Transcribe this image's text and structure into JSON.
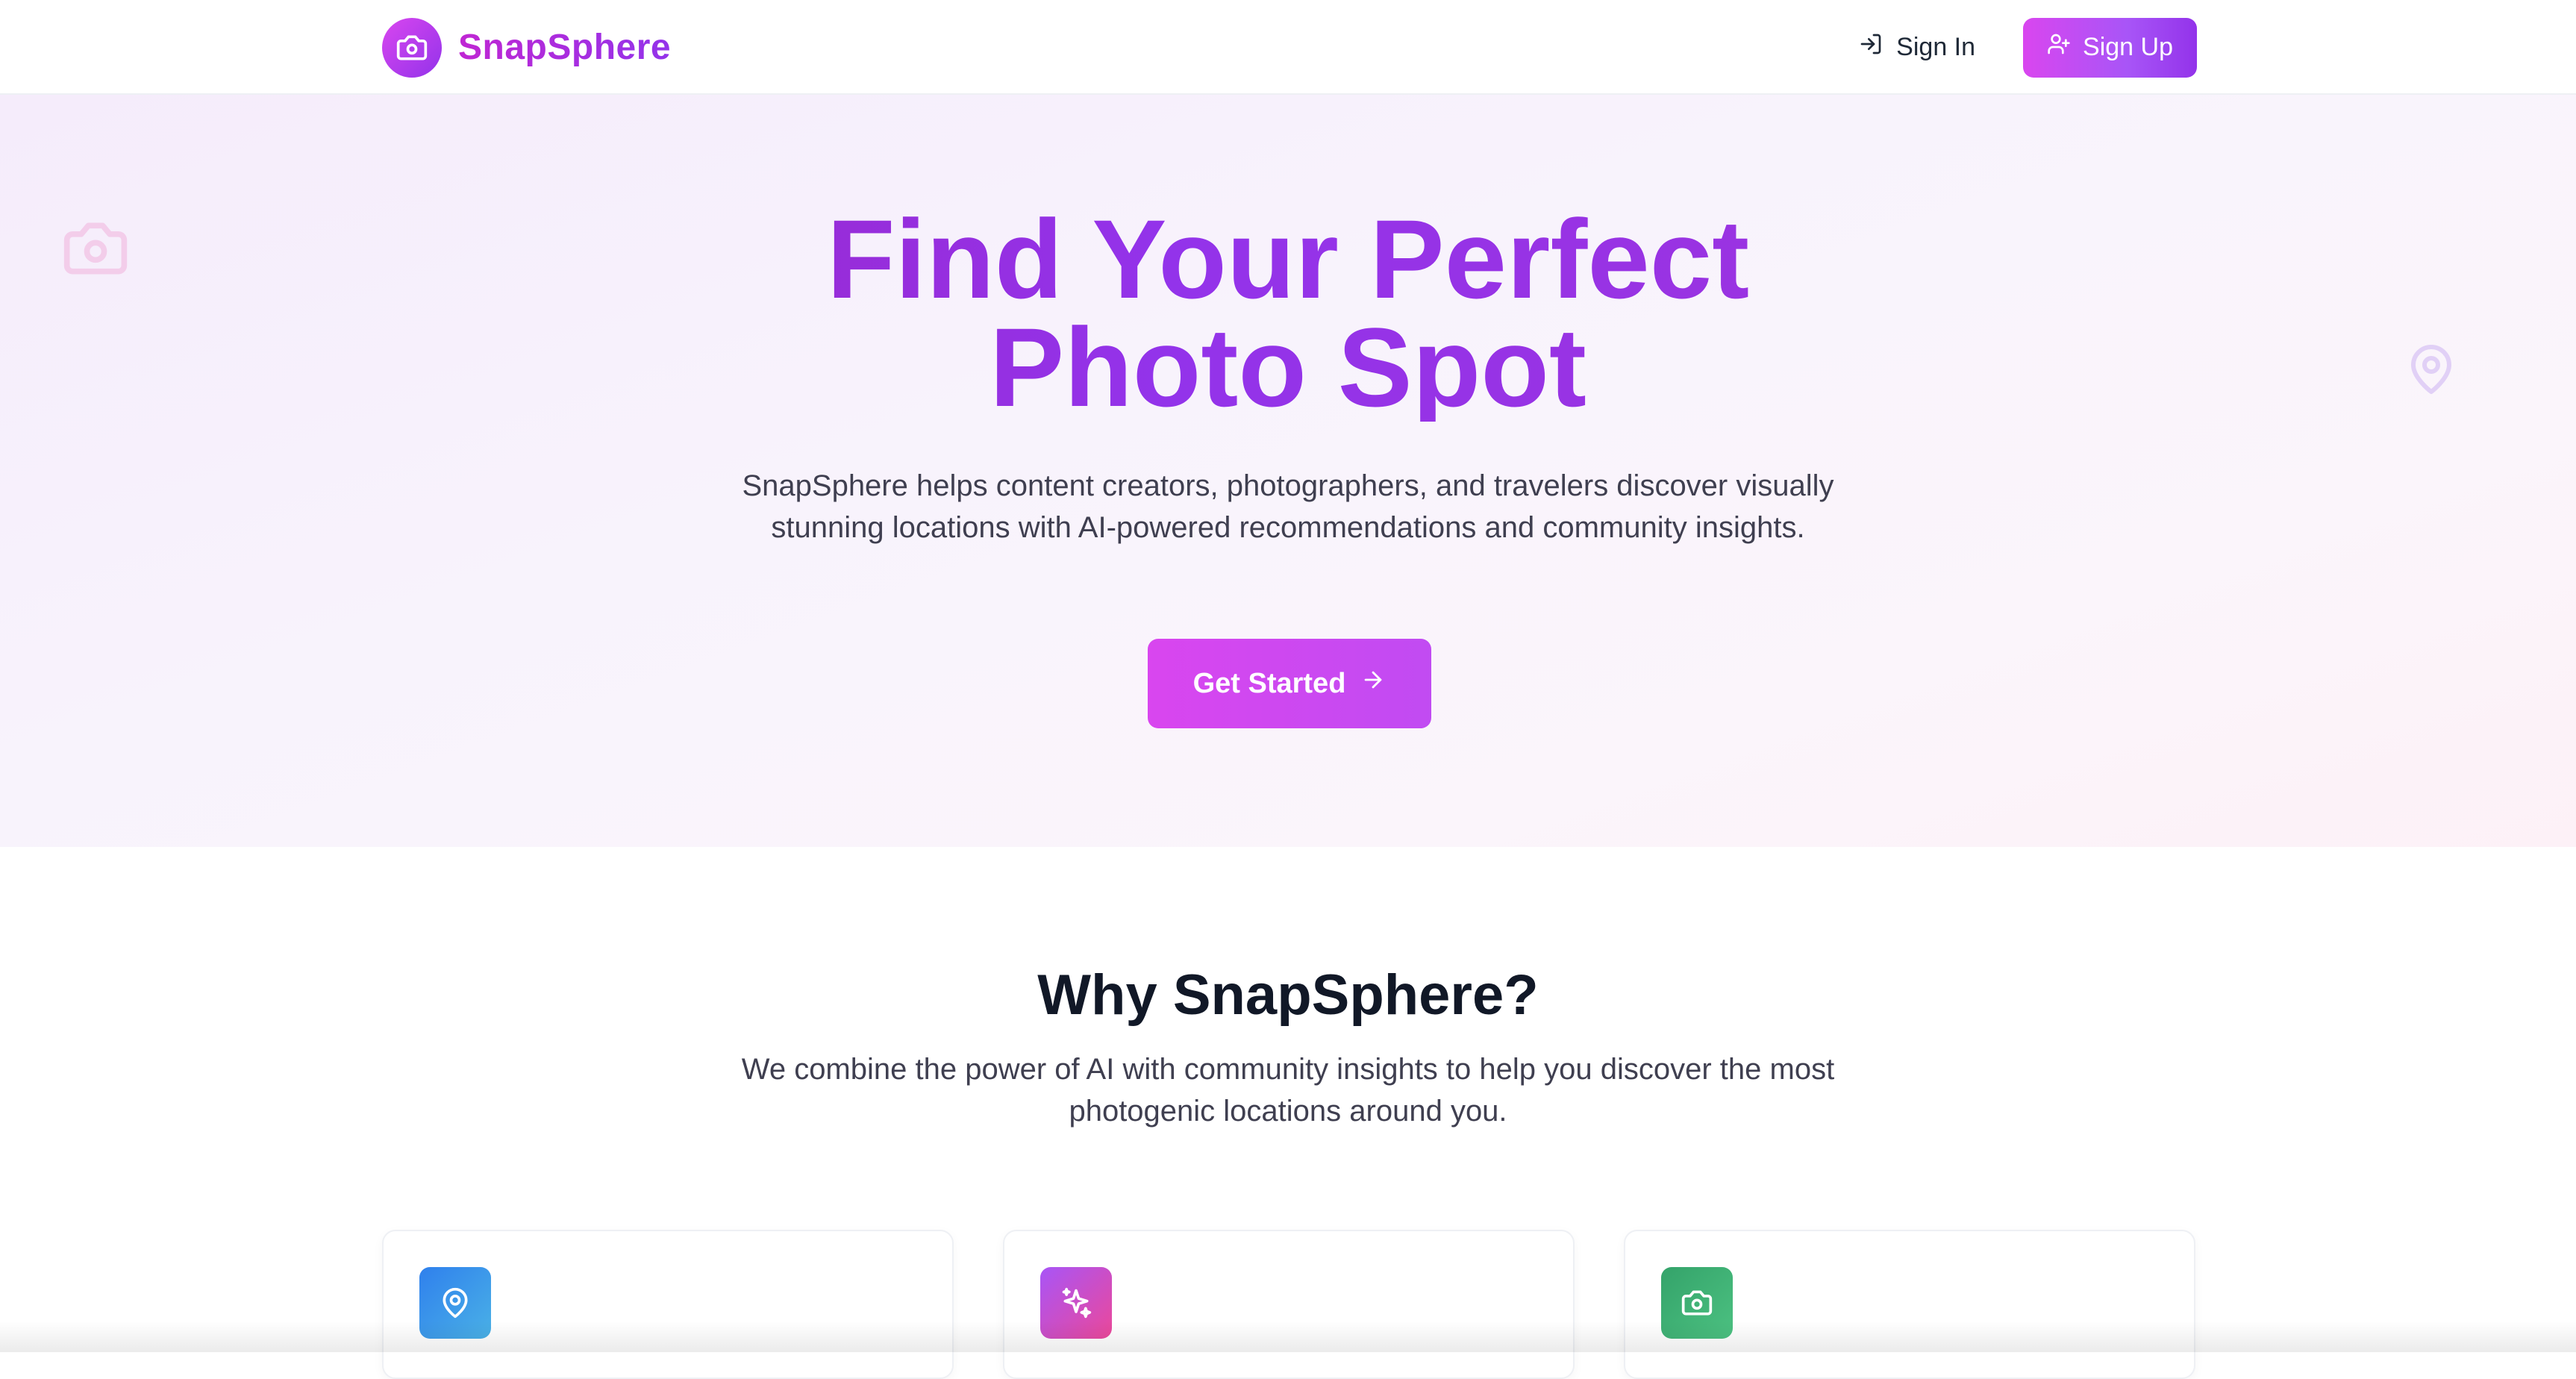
{
  "brand": {
    "name": "SnapSphere",
    "logo_icon": "camera-icon"
  },
  "nav": {
    "signin_label": "Sign In",
    "signin_icon": "log-in-icon",
    "signup_label": "Sign Up",
    "signup_icon": "user-plus-icon"
  },
  "hero": {
    "title_line1": "Find Your Perfect",
    "title_line2": "Photo Spot",
    "subtitle": "SnapSphere helps content creators, photographers, and travelers discover visually stunning locations with AI-powered recommendations and community insights.",
    "cta_label": "Get Started",
    "cta_icon": "arrow-right-icon",
    "decorations": [
      "camera-icon",
      "map-pin-icon"
    ]
  },
  "why": {
    "title": "Why SnapSphere?",
    "subtitle": "We combine the power of AI with community insights to help you discover the most photogenic locations around you.",
    "cards": [
      {
        "icon": "map-pin-icon",
        "color": "#3b82f6"
      },
      {
        "icon": "sparkles-icon",
        "color": "#d946ef"
      },
      {
        "icon": "camera-icon",
        "color": "#22c55e"
      }
    ]
  },
  "colors": {
    "brand_gradient_start": "#d946ef",
    "brand_gradient_end": "#9333ea",
    "text_dark": "#111827",
    "text_body": "#3f3f50"
  }
}
